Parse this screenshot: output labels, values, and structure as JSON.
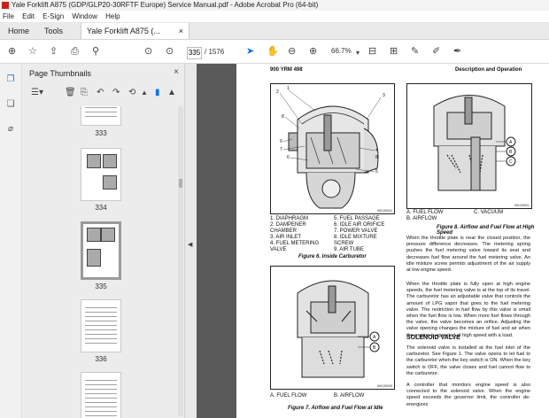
{
  "window": {
    "title": "Yale Forklift A875 (GDP/GLP20-30RFTF Europe) Service Manual.pdf - Adobe Acrobat Pro (64-bit)"
  },
  "menu": [
    "File",
    "Edit",
    "E-Sign",
    "Window",
    "Help"
  ],
  "tabs": {
    "home": "Home",
    "tools": "Tools",
    "doc": "Yale Forklift A875 (...",
    "close": "×"
  },
  "toolbar": {
    "page_current": "335",
    "page_total": "/ 1576",
    "zoom": "66.7%"
  },
  "panel": {
    "title": "Page Thumbnails",
    "close": "×"
  },
  "thumbnails": [
    {
      "label": "333"
    },
    {
      "label": "334"
    },
    {
      "label": "335"
    },
    {
      "label": "336"
    },
    {
      "label": "337"
    }
  ],
  "page": {
    "header_left": "900 YRM 498",
    "header_right": "Description and Operation",
    "fig6_legend_left": [
      "1.  DIAPHRAGM",
      "2.  DAMPENER",
      "     CHAMBER",
      "3.  AIR INLET",
      "4.  FUEL METERING",
      "     VALVE"
    ],
    "fig6_legend_right": [
      "5.  FUEL PASSAGE",
      "6.  IDLE AIR ORIFICE",
      "7.  POWER VALVE",
      "8.  IDLE MIXTURE",
      "     SCREW",
      "9.  AIR TUBE"
    ],
    "fig6_caption": "Figure 6. Inside Carburetor",
    "fig7_legend": [
      "A.  FUEL FLOW",
      "B.  AIRFLOW"
    ],
    "fig7_caption": "Figure 7. Airflow and Fuel Flow at Idle",
    "fig8_legend_left": [
      "A.  FUEL FLOW",
      "B.  AIRFLOW"
    ],
    "fig8_legend_right": [
      "C.  VACUUM"
    ],
    "fig8_caption": "Figure 8. Airflow and Fuel Flow at High Speed",
    "para1": "When the throttle plate is near the closed position, the pressure difference decreases. The metering spring pushes the fuel metering valve toward its seat and decreases fuel flow around the fuel metering valve. An idle mixture screw permits adjustment of the air supply at low engine speed.",
    "para2": "When the throttle plate is fully open at high engine speeds, the fuel metering valve is at the top of its travel. The carburetor has an adjustable valve that controls the amount of LPG vapor that goes to the fuel metering valve. The restriction in fuel flow by this valve is small when the fuel flow is low. When more fuel flows through the valve, the valve becomes an orifice. Adjusting the valve opening changes the mixture of fuel and air when the engine is operated at high speed with a load.",
    "section": "SOLENOID VALVE",
    "para3": "The solenoid valve is installed at the fuel inlet of the carburetor. See Figure 1. The valve opens to let fuel to the carburetor when the key switch is ON. When the key switch is OFF, the valve closes and fuel cannot flow to the carburetor.",
    "para4": "A controller that monitors engine speed is also connected to the solenoid valve. When the engine speed exceeds the governor limit, the controller de-energizes",
    "fig6_id": "HM135004",
    "fig7_id": "HM135005",
    "fig8_id": "HM135001",
    "callouts": [
      "A",
      "B",
      "C"
    ]
  },
  "colors": {
    "accent": "#c8231c",
    "select_blue": "#1473e6"
  }
}
